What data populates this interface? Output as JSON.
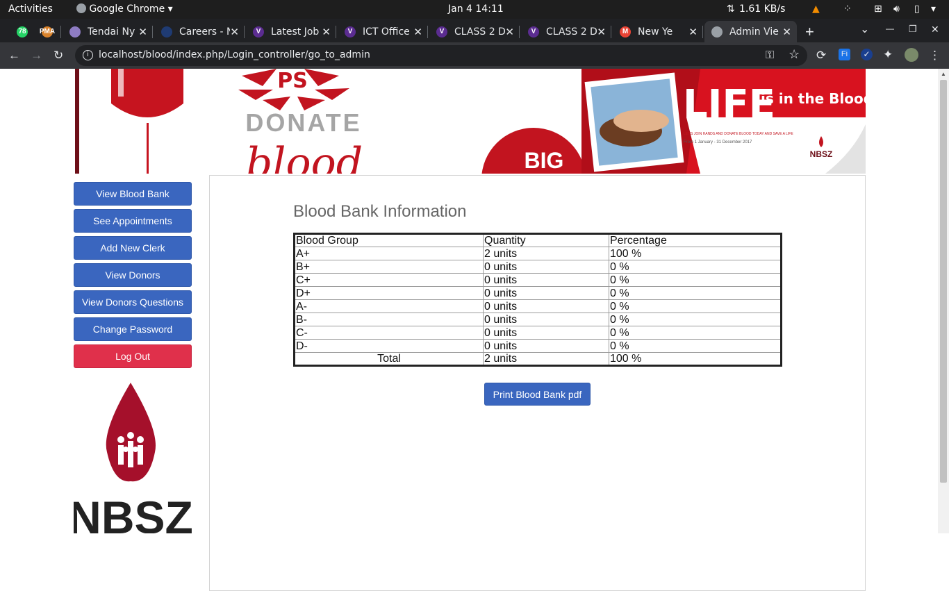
{
  "system_bar": {
    "activities": "Activities",
    "app_name": "Google Chrome",
    "datetime": "Jan 4  14:11",
    "net_speed": "1.61 KB/s"
  },
  "tabs": [
    {
      "title": "",
      "favicon": "whatsapp-icon",
      "badge": "78",
      "color": "#25d366"
    },
    {
      "title": "",
      "favicon": "pma-icon",
      "badge": "PMA",
      "color": "#d9822b"
    },
    {
      "title": "Tendai Ny",
      "favicon": "site-icon",
      "color": "#8e7cc3"
    },
    {
      "title": "Careers - N",
      "favicon": "site-icon",
      "color": "#1f3b73"
    },
    {
      "title": "Latest Job",
      "favicon": "v-icon",
      "badge": "V",
      "color": "#5b2c91"
    },
    {
      "title": "ICT Office",
      "favicon": "v-icon",
      "badge": "V",
      "color": "#5b2c91"
    },
    {
      "title": "CLASS 2 D",
      "favicon": "v-icon",
      "badge": "V",
      "color": "#5b2c91"
    },
    {
      "title": "CLASS 2 D",
      "favicon": "v-icon",
      "badge": "V",
      "color": "#5b2c91"
    },
    {
      "title": "New Ye",
      "favicon": "gmail-icon",
      "badge": "M",
      "color": "#ea4335"
    },
    {
      "title": "Admin Vie",
      "favicon": "globe-icon",
      "badge": "",
      "color": "#9aa0a6"
    }
  ],
  "address_bar": {
    "url": "localhost/blood/index.php/Login_controller/go_to_admin"
  },
  "banner": {
    "logo_text": "PS",
    "donate_text": "DONATE",
    "script_text": "blood",
    "big_text": "BIG",
    "life_text": "LIFE",
    "life_suffix": "is in the Blood",
    "tagline": "LET'S JOIN HANDS AND DONATE BLOOD TODAY AND SAVE A LIFE",
    "dates": "From 1 January - 31 December 2017",
    "org_short": "NBSZ"
  },
  "sidebar": {
    "buttons": [
      {
        "label": "View Blood Bank"
      },
      {
        "label": "See Appointments"
      },
      {
        "label": "Add New Clerk"
      },
      {
        "label": "View Donors"
      },
      {
        "label": "View Donors Questions"
      },
      {
        "label": "Change Password"
      },
      {
        "label": "Log Out"
      }
    ],
    "logo_text": "NBSZ"
  },
  "main": {
    "title": "Blood Bank Information",
    "table": {
      "headers": [
        "Blood Group",
        "Quantity",
        "Percentage"
      ],
      "rows": [
        [
          "A+",
          "2 units",
          "100 %"
        ],
        [
          "B+",
          "0 units",
          "0 %"
        ],
        [
          "C+",
          "0 units",
          "0 %"
        ],
        [
          "D+",
          "0 units",
          "0 %"
        ],
        [
          "A-",
          "0 units",
          "0 %"
        ],
        [
          "B-",
          "0 units",
          "0 %"
        ],
        [
          "C-",
          "0 units",
          "0 %"
        ],
        [
          "D-",
          "0 units",
          "0 %"
        ]
      ],
      "total": [
        "Total",
        "2 units",
        "100 %"
      ]
    },
    "print_button": "Print Blood Bank pdf"
  },
  "colors": {
    "primary_button": "#3a66bf",
    "danger_button": "#e0304b",
    "brand_red": "#b5102a"
  }
}
